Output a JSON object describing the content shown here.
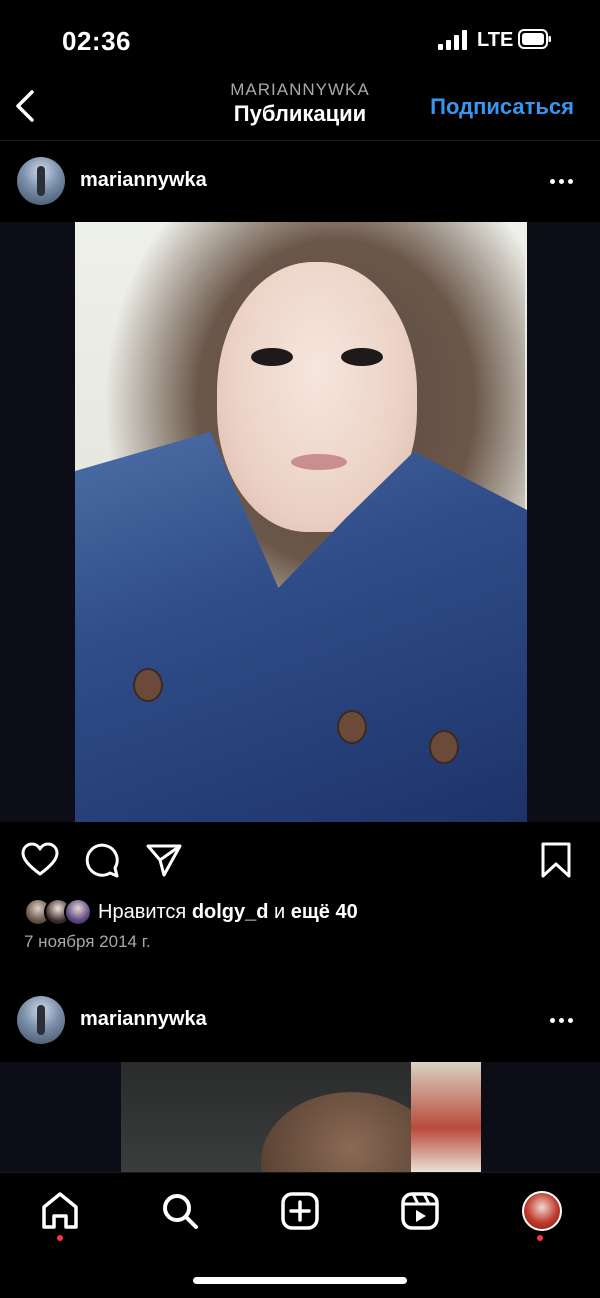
{
  "status_bar": {
    "time": "02:36",
    "network": "LTE"
  },
  "header": {
    "username": "MARIANNYWKA",
    "title": "Публикации",
    "follow_label": "Подписаться"
  },
  "posts": [
    {
      "username": "mariannywka",
      "likes": {
        "prefix": "Нравится ",
        "user": "dolgy_d",
        "middle": " и ",
        "more": "ещё 40"
      },
      "date": "7 ноября 2014 г."
    },
    {
      "username": "mariannywka"
    }
  ],
  "nav": {
    "items": [
      "home-icon",
      "search-icon",
      "new-post-icon",
      "reels-icon",
      "profile-avatar"
    ],
    "notification_dot_color": "#ff3040"
  },
  "colors": {
    "accent": "#3797f0",
    "background": "#000000",
    "secondary_text": "#a8a8a8"
  }
}
